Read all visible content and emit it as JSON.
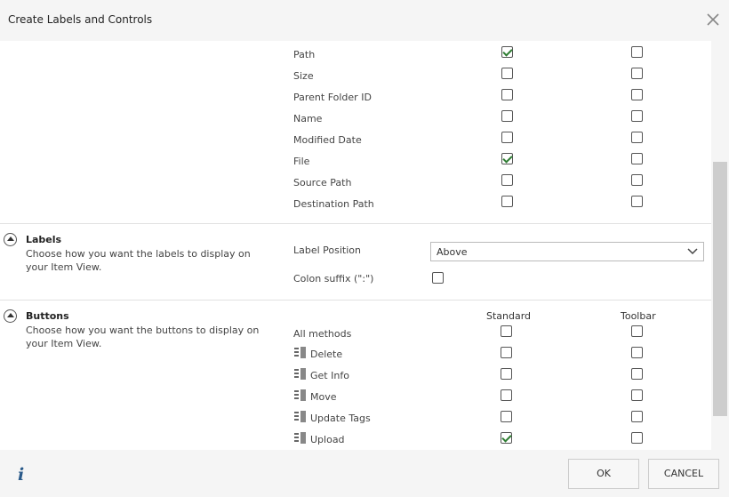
{
  "dialog": {
    "title": "Create Labels and Controls"
  },
  "properties": {
    "rows": [
      {
        "label": "Path",
        "col1": true,
        "col2": false
      },
      {
        "label": "Size",
        "col1": false,
        "col2": false
      },
      {
        "label": "Parent Folder ID",
        "col1": false,
        "col2": false
      },
      {
        "label": "Name",
        "col1": false,
        "col2": false
      },
      {
        "label": "Modified Date",
        "col1": false,
        "col2": false
      },
      {
        "label": "File",
        "col1": true,
        "col2": false
      },
      {
        "label": "Source Path",
        "col1": false,
        "col2": false
      },
      {
        "label": "Destination Path",
        "col1": false,
        "col2": false
      }
    ]
  },
  "labels_section": {
    "title": "Labels",
    "description": "Choose how you want the labels to display on your Item View.",
    "label_position_label": "Label Position",
    "label_position_value": "Above",
    "colon_suffix_label": "Colon suffix (\":\")",
    "colon_suffix_checked": false
  },
  "buttons_section": {
    "title": "Buttons",
    "description": "Choose how you want the buttons to display on your Item View.",
    "col_standard": "Standard",
    "col_toolbar": "Toolbar",
    "all_methods_label": "All methods",
    "methods": [
      {
        "label": "Delete",
        "standard": false,
        "toolbar": false
      },
      {
        "label": "Get Info",
        "standard": false,
        "toolbar": false
      },
      {
        "label": "Move",
        "standard": false,
        "toolbar": false
      },
      {
        "label": "Update Tags",
        "standard": false,
        "toolbar": false
      },
      {
        "label": "Upload",
        "standard": true,
        "toolbar": false
      }
    ]
  },
  "footer": {
    "ok_label": "OK",
    "cancel_label": "CANCEL"
  }
}
